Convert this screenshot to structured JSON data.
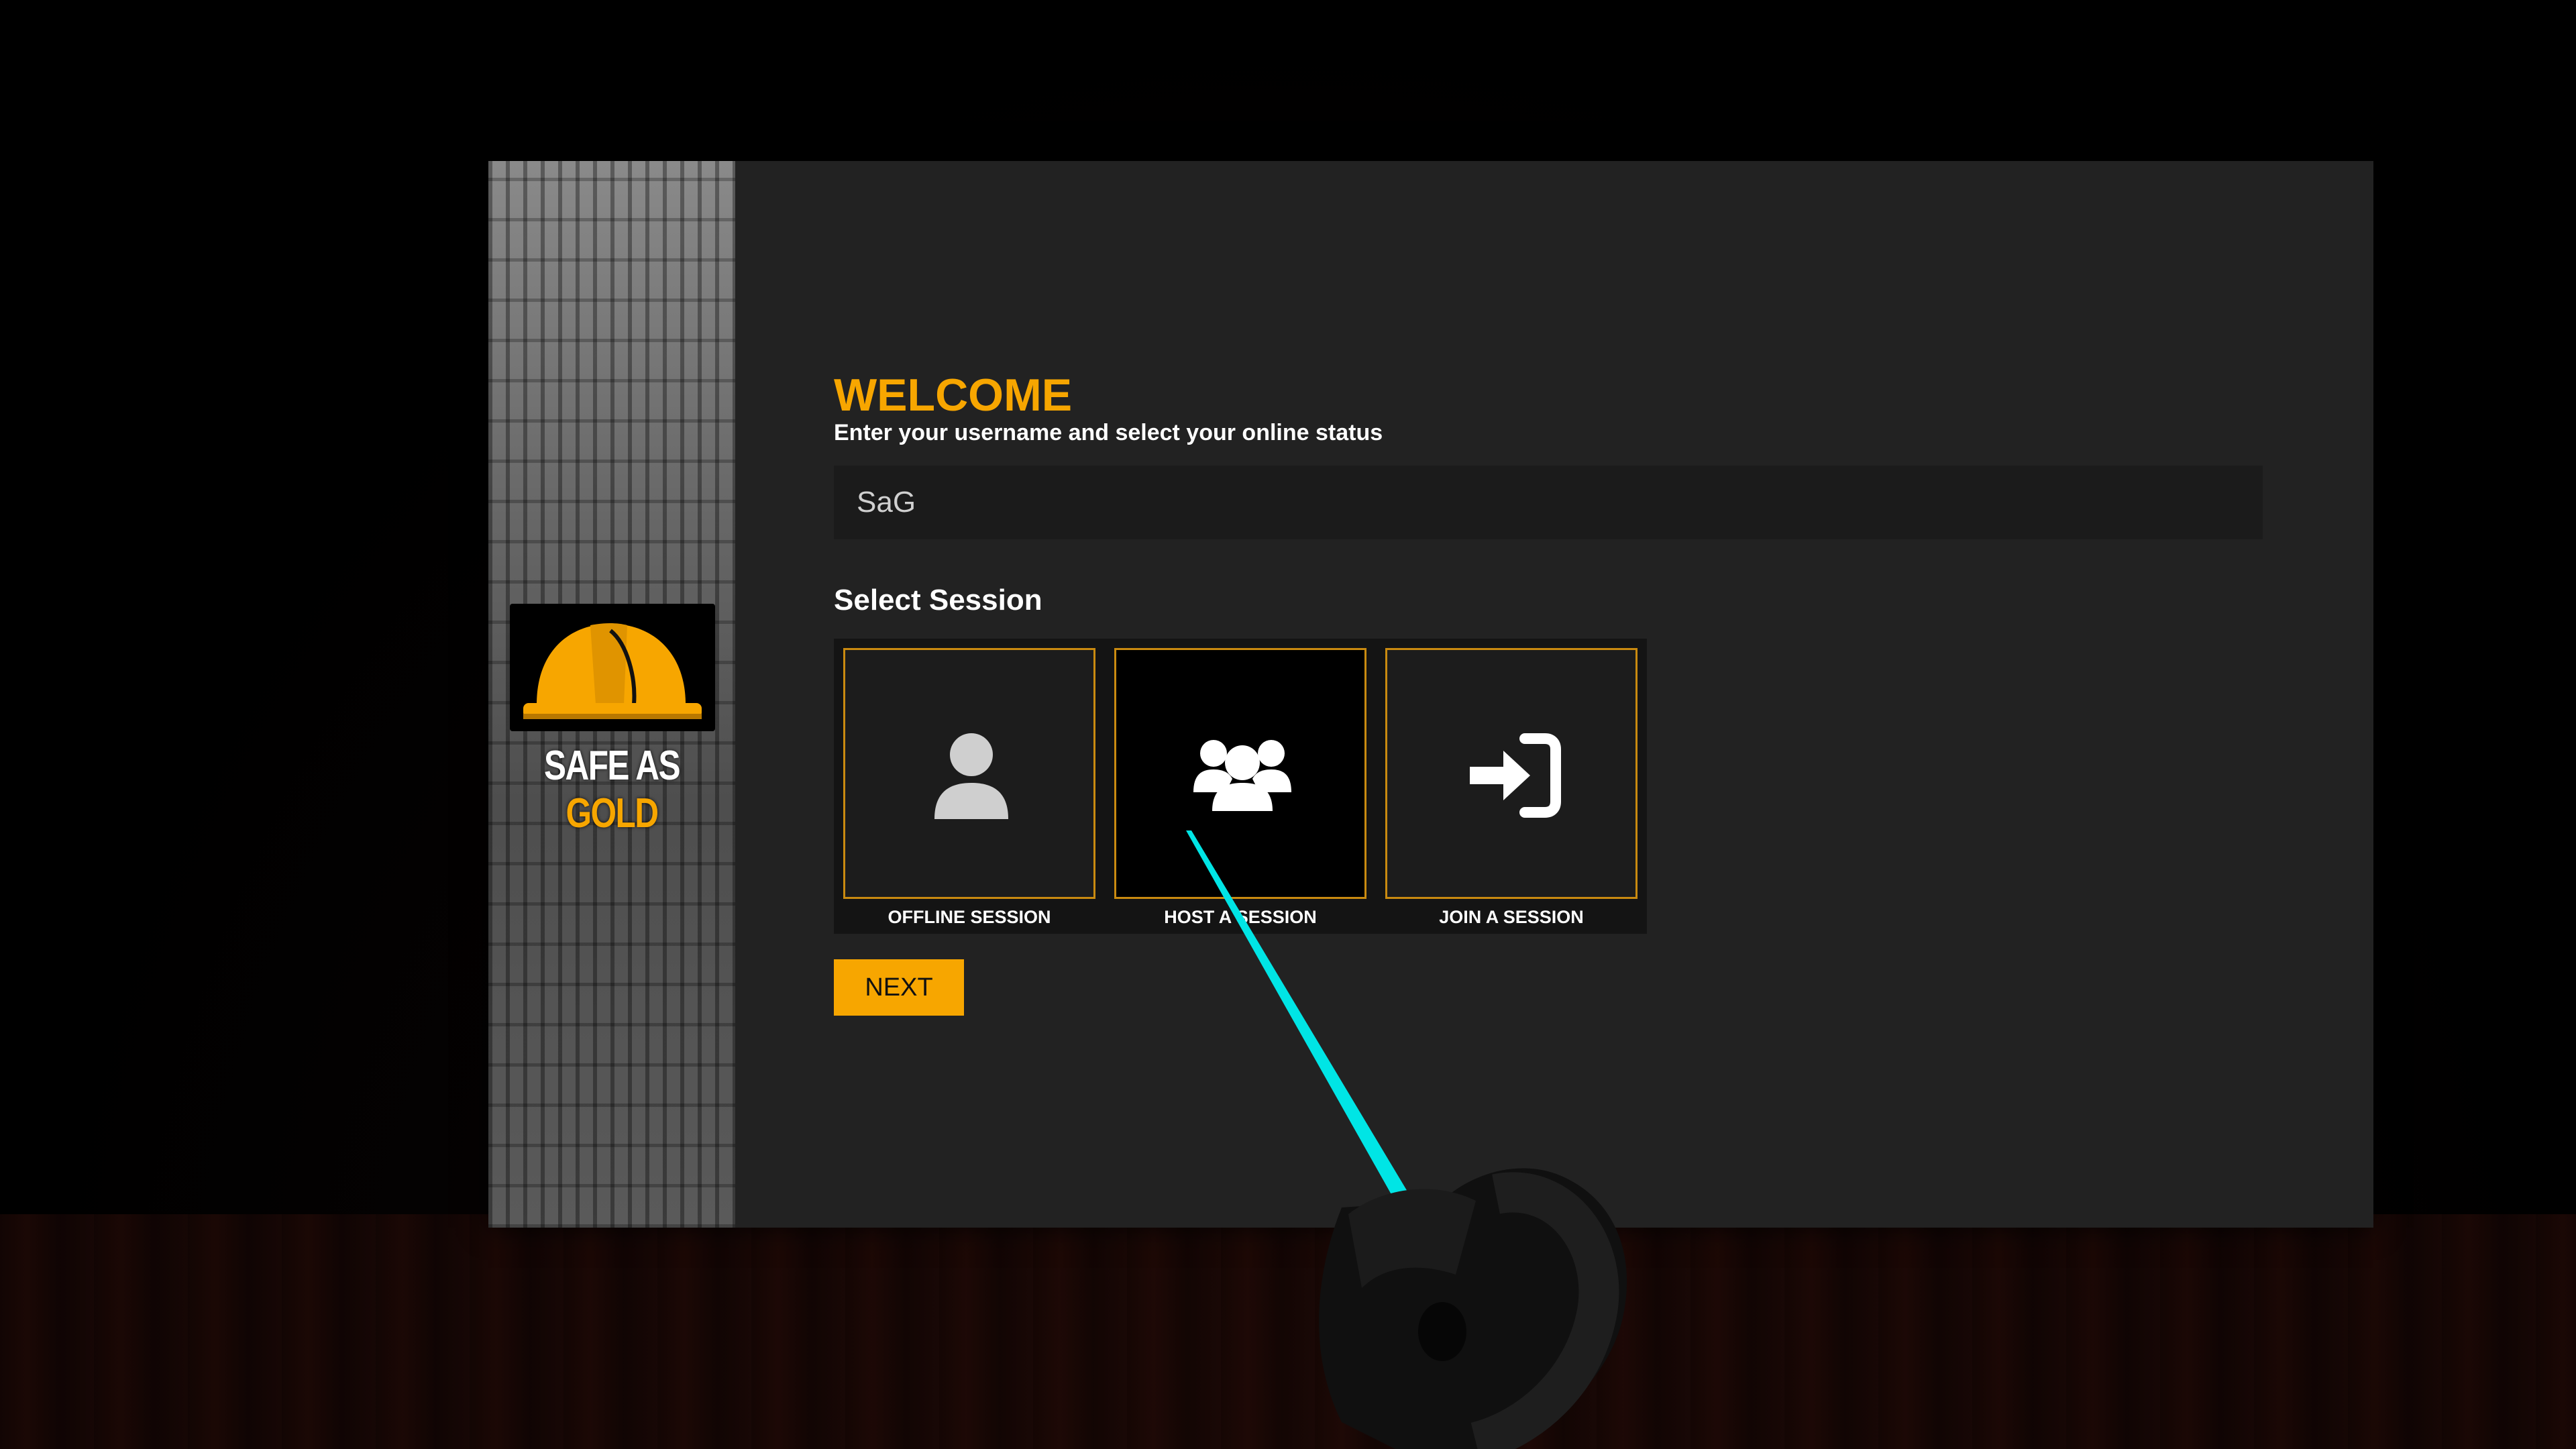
{
  "brand": {
    "name_white": "SAFE AS ",
    "name_gold": "GOLD",
    "accent_color": "#f7a600"
  },
  "welcome": {
    "title": "WELCOME",
    "subtitle": "Enter your username and select your online status"
  },
  "username": {
    "value": "SaG"
  },
  "session": {
    "label": "Select Session",
    "options": [
      {
        "label": "OFFLINE SESSION",
        "icon": "user-icon",
        "selected": false
      },
      {
        "label": "HOST A SESSION",
        "icon": "users-icon",
        "selected": true
      },
      {
        "label": "JOIN A SESSION",
        "icon": "sign-in-icon",
        "selected": false
      }
    ]
  },
  "next_button": {
    "label": "NEXT"
  },
  "colors": {
    "panel": "#222222",
    "laser": "#00e5e5"
  }
}
